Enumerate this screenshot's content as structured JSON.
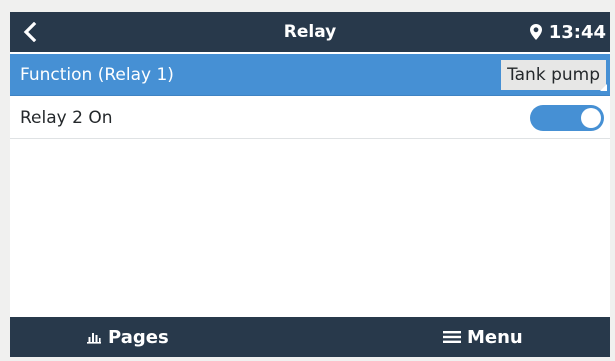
{
  "header": {
    "title": "Relay",
    "time": "13:44",
    "back_icon": "chevron-left-icon",
    "location_icon": "map-pin-icon"
  },
  "rows": [
    {
      "label": "Function (Relay 1)",
      "value": "Tank pump",
      "selected": true
    },
    {
      "label": "Relay 2 On",
      "toggle_on": true,
      "selected": false
    }
  ],
  "footer": {
    "pages_label": "Pages",
    "menu_label": "Menu",
    "pages_icon": "bar-chart-icon",
    "menu_icon": "hamburger-icon"
  },
  "colors": {
    "header_bg": "#28394b",
    "accent": "#4690d4",
    "page_bg": "#ffffff"
  }
}
